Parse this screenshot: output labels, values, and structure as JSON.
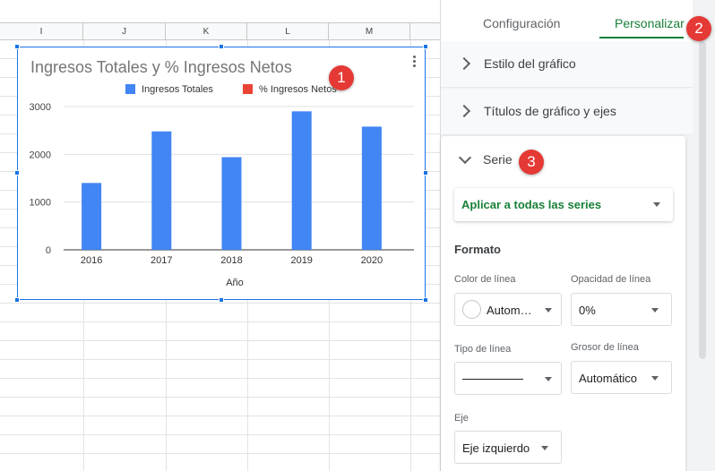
{
  "sheet": {
    "columns": [
      "I",
      "J",
      "K",
      "L",
      "M"
    ]
  },
  "chart": {
    "title": "Ingresos Totales y % Ingresos Netos",
    "xlabel": "Año",
    "legend": [
      "Ingresos Totales",
      "% Ingresos Netos"
    ]
  },
  "chart_data": {
    "type": "bar",
    "title": "Ingresos Totales y % Ingresos Netos",
    "xlabel": "Año",
    "ylabel": "",
    "categories": [
      "2016",
      "2017",
      "2018",
      "2019",
      "2020"
    ],
    "series": [
      {
        "name": "Ingresos Totales",
        "values": [
          1400,
          2480,
          1940,
          2900,
          2580
        ],
        "color": "#4285f4"
      },
      {
        "name": "% Ingresos Netos",
        "values": [
          0,
          0,
          0,
          0,
          0
        ],
        "color": "#ea4335"
      }
    ],
    "yticks": [
      "0",
      "1000",
      "2000",
      "3000"
    ],
    "ylim": [
      0,
      3000
    ],
    "grid": true,
    "legend_position": "top"
  },
  "badges": [
    "1",
    "2",
    "3"
  ],
  "panel": {
    "tabs": [
      "Configuración",
      "Personalizar"
    ],
    "sections": [
      "Estilo del gráfico",
      "Títulos de gráfico y ejes",
      "Serie"
    ],
    "apply_to": "Aplicar a todas las series",
    "formato_label": "Formato",
    "line_color_label": "Color de línea",
    "line_color_value": "Autom…",
    "line_opacity_label": "Opacidad de línea",
    "line_opacity_value": "0%",
    "line_type_label": "Tipo de línea",
    "line_thickness_label": "Grosor de línea",
    "line_thickness_value": "Automático",
    "axis_label": "Eje",
    "axis_value": "Eje izquierdo"
  },
  "colors": {
    "accent_green": "#188038",
    "selection_blue": "#1a73e8",
    "badge_red": "#e53935"
  }
}
